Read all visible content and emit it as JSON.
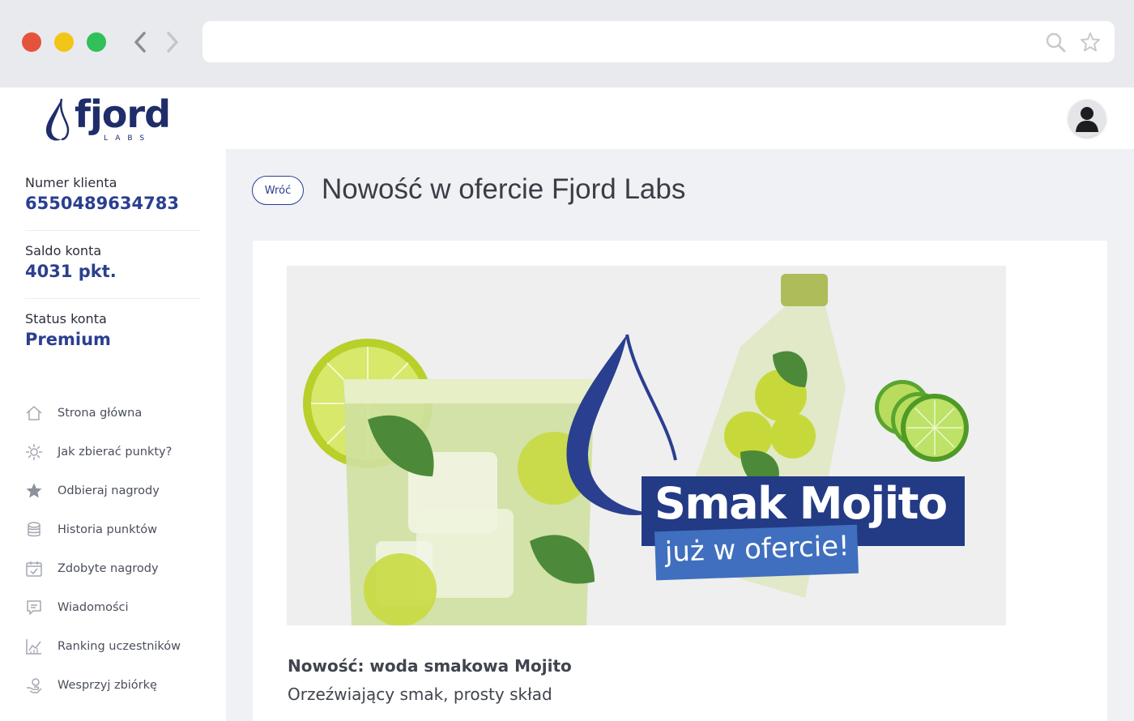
{
  "browser": {
    "icons": {
      "back": "chevron-left-icon",
      "forward": "chevron-right-icon",
      "search": "search-icon",
      "bookmark": "star-icon"
    }
  },
  "header": {
    "logo_text": "fjord",
    "logo_sub": "LABS"
  },
  "sidebar": {
    "client_number_label": "Numer klienta",
    "client_number_value": "6550489634783",
    "balance_label": "Saldo konta",
    "balance_value": "4031 pkt.",
    "status_label": "Status konta",
    "status_value": "Premium",
    "menu": [
      {
        "label": "Strona główna",
        "icon": "home-icon"
      },
      {
        "label": "Jak zbierać punkty?",
        "icon": "sparkle-icon"
      },
      {
        "label": "Odbieraj nagrody",
        "icon": "star-icon"
      },
      {
        "label": "Historia punktów",
        "icon": "coins-icon"
      },
      {
        "label": "Zdobyte nagrody",
        "icon": "calendar-check-icon"
      },
      {
        "label": "Wiadomości",
        "icon": "message-icon"
      },
      {
        "label": "Ranking uczestników",
        "icon": "chart-icon"
      },
      {
        "label": "Wesprzyj zbiórkę",
        "icon": "donate-icon"
      }
    ]
  },
  "main": {
    "back_label": "Wróć",
    "title": "Nowość w ofercie Fjord Labs",
    "banner": {
      "headline": "Smak Mojito",
      "subline": "już w ofercie!"
    },
    "article_title": "Nowość: woda smakowa Mojito",
    "article_subtitle": "Orzeźwiający smak, prosty skład"
  },
  "colors": {
    "brand": "#2a3f8f",
    "banner_dark": "#233a85",
    "banner_light": "#3f6fbe",
    "background": "#f0f1f5"
  }
}
